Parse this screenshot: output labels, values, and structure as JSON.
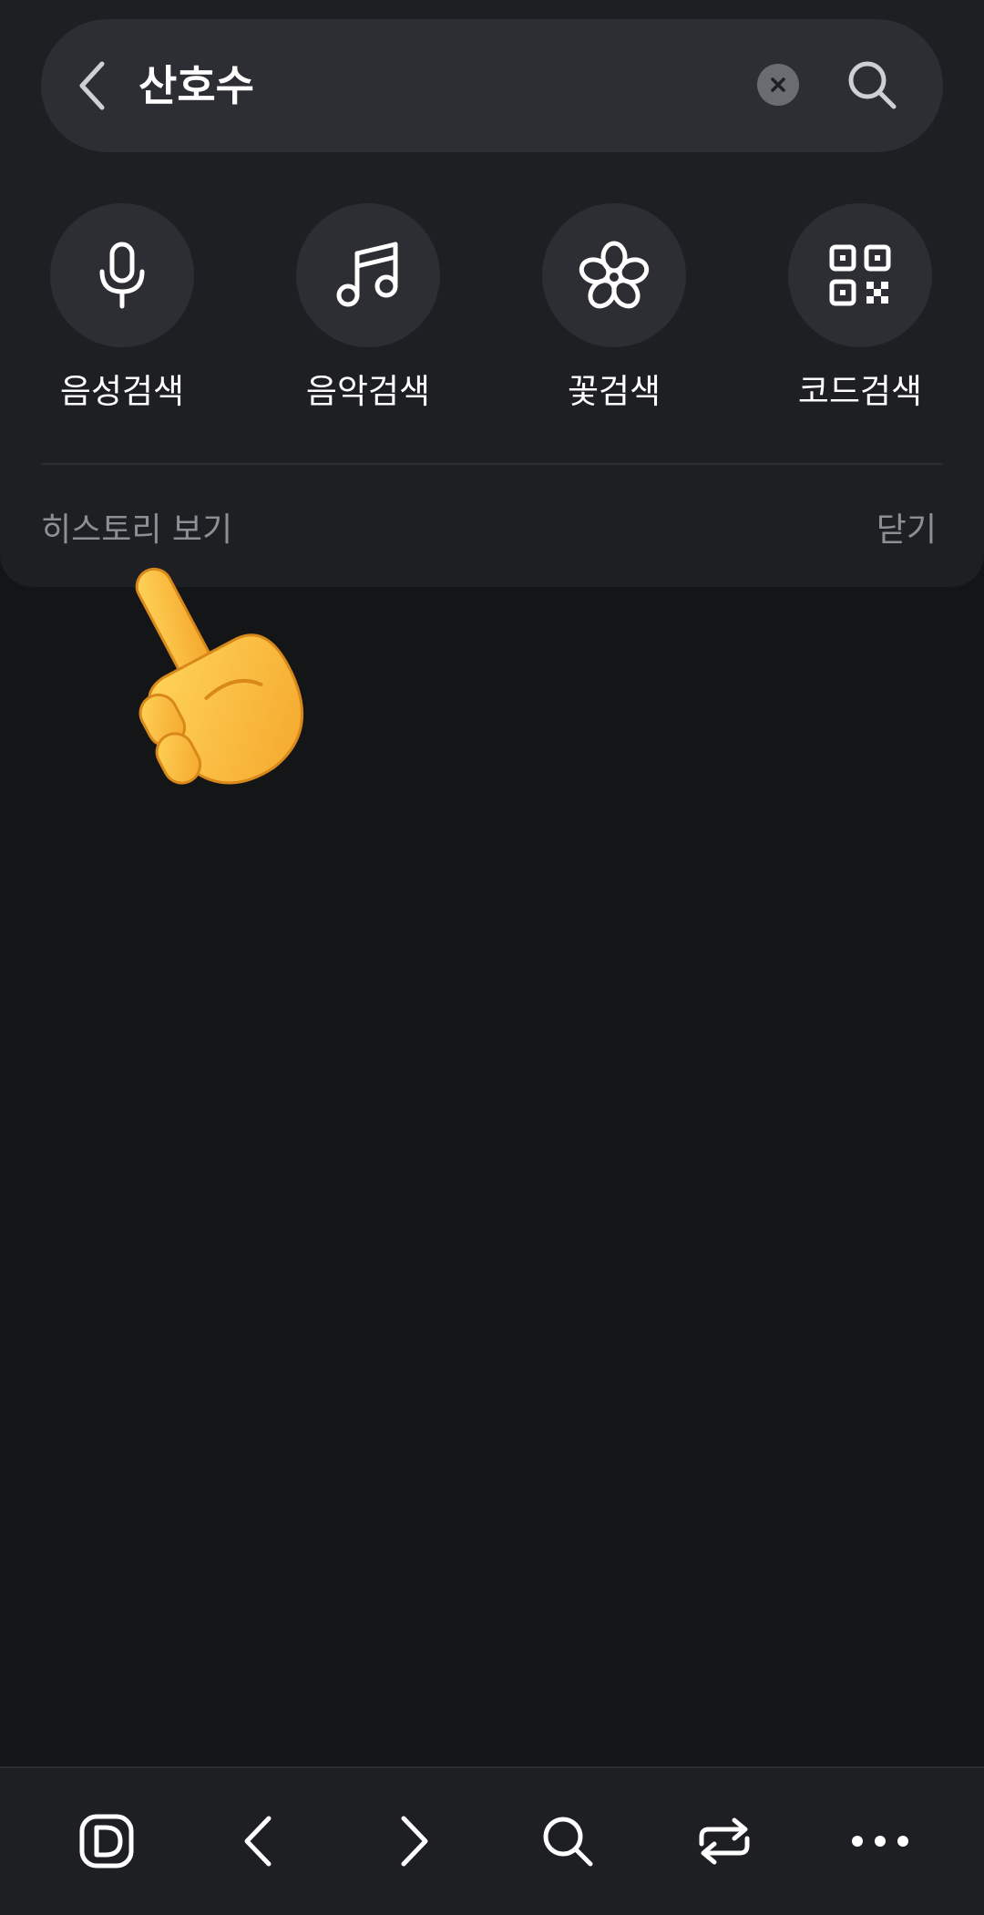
{
  "search": {
    "query": "산호수"
  },
  "quick_search": [
    {
      "label": "음성검색",
      "icon": "microphone-icon"
    },
    {
      "label": "음악검색",
      "icon": "music-note-icon"
    },
    {
      "label": "꽃검색",
      "icon": "flower-icon"
    },
    {
      "label": "코드검색",
      "icon": "qr-code-icon"
    }
  ],
  "footer": {
    "history_label": "히스토리 보기",
    "close_label": "닫기"
  },
  "toolbar": {
    "icons": [
      "daum-logo-icon",
      "back-arrow-icon",
      "forward-arrow-icon",
      "search-icon",
      "tabs-switch-icon",
      "more-icon"
    ]
  },
  "colors": {
    "background": "#141517",
    "panel": "#1e1f23",
    "surface": "#2d2e33",
    "muted_text": "#8e8f94"
  }
}
